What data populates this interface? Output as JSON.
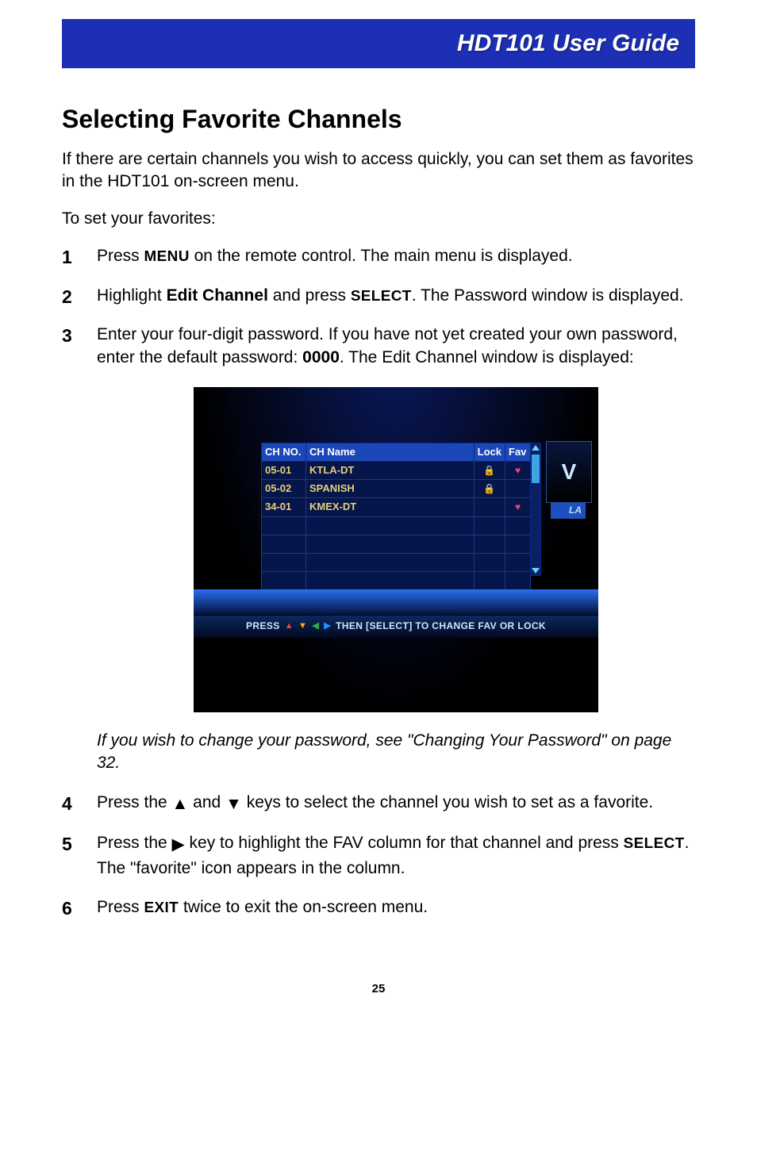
{
  "header": {
    "title": "HDT101 User Guide"
  },
  "heading": "Selecting Favorite Channels",
  "intro": "If there are certain channels you wish to access quickly, you can set them as favorites in the HDT101 on-screen menu.",
  "lead": "To set your favorites:",
  "steps": {
    "s1": {
      "num": "1",
      "a": "Press ",
      "menu": "MENU",
      "b": " on the remote control. The main menu is displayed."
    },
    "s2": {
      "num": "2",
      "a": "Highlight ",
      "bold": "Edit Channel",
      "b": " and press ",
      "select": "SELECT",
      "c": ". The Password window is displayed."
    },
    "s3": {
      "num": "3",
      "a": "Enter your four-digit password. If you have not yet created your own password, enter the default password: ",
      "bold": "0000",
      "b": ". The Edit Channel window is displayed:"
    },
    "note": "If you wish to change your password, see \"Changing Your Password\" on page 32.",
    "s4": {
      "num": "4",
      "a": "Press the ",
      "up": "▲",
      "b": " and ",
      "down": "▼",
      "c": " keys to select the channel you wish to set as a favorite."
    },
    "s5": {
      "num": "5",
      "a": "Press the ",
      "right": "▶",
      "b": " key to highlight the FAV column for that channel and press ",
      "select": "SELECT",
      "c": ". The \"favorite\" icon appears in the column."
    },
    "s6": {
      "num": "6",
      "a": "Press ",
      "exit": "EXIT",
      "b": " twice to exit the on-screen menu."
    }
  },
  "screenshot": {
    "columns": {
      "chno": "CH NO.",
      "chname": "CH   Name",
      "lock": "Lock",
      "fav": "Fav"
    },
    "rows": [
      {
        "chno": "05-01",
        "chname": "KTLA-DT",
        "lock": true,
        "fav": true
      },
      {
        "chno": "05-02",
        "chname": "SPANISH",
        "lock": true,
        "fav": false
      },
      {
        "chno": "34-01",
        "chname": "KMEX-DT",
        "lock": false,
        "fav": true
      }
    ],
    "empty_rows": 5,
    "pip_text": "V",
    "pip_label": "LA",
    "hint": {
      "press": "PRESS",
      "rest": "THEN [SELECT] TO CHANGE FAV OR LOCK"
    }
  },
  "page_number": "25"
}
